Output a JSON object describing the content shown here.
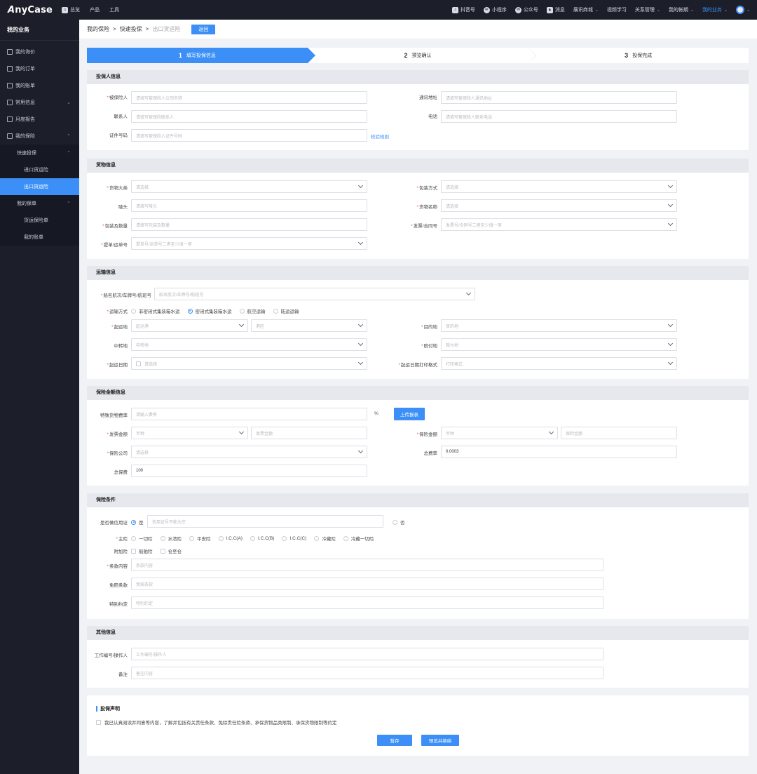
{
  "brand": {
    "logo_prefix": "A",
    "logo_rest": "nyCase"
  },
  "topnav": {
    "overview": "总览",
    "product": "产品",
    "tools": "工具"
  },
  "topright": {
    "douyin": "抖音号",
    "miniprogram": "小程序",
    "official": "公众号",
    "message": "消息",
    "mall": "展讯商城",
    "learning": "视频学习",
    "relation": "关系管理",
    "mine": "我的帐期",
    "business": "我的业务"
  },
  "sidebar": {
    "title": "我的业务",
    "items": [
      "我的询价",
      "我的订单",
      "我的账单",
      "常用信息",
      "月度报告",
      "我的保险",
      "快速投保",
      "进口货运险",
      "出口货运险",
      "我的保单",
      "货运保险单",
      "我的账单"
    ]
  },
  "breadcrumb": {
    "a": "我的保险",
    "b": "快速投保",
    "c": "出口货运险",
    "back": "返回",
    "sep": ">"
  },
  "steps": [
    {
      "num": "1",
      "label": "填写投保信息"
    },
    {
      "num": "2",
      "label": "预览确认"
    },
    {
      "num": "3",
      "label": "投保完成"
    }
  ],
  "insurer": {
    "title": "投保人信息",
    "insured_label": "被保险人",
    "insured_ph": "请填写被保险人公司名称",
    "address_label": "通讯地址",
    "address_ph": "请填写被保险人通讯地址",
    "contact_label": "联系人",
    "contact_ph": "请填写被保险联系人",
    "phone_label": "电话",
    "phone_ph": "请填写被保险人联系电话",
    "id_label": "证件号码",
    "id_ph": "请填写被保险人证件号码",
    "rule_link": "校验规则"
  },
  "goods": {
    "title": "货物信息",
    "category_label": "货物大类",
    "category_ph": "请选择",
    "pack_label": "包装方式",
    "pack_ph": "请选择",
    "mark_label": "唛头",
    "mark_ph": "请填写唛头",
    "name_label": "货物名称",
    "name_ph": "请选择",
    "qty_label": "包装及数量",
    "qty_ph": "请填写包装及数量",
    "invoice_label": "发票/合同号",
    "invoice_ph": "发票号/合同号二者至少填一项",
    "bl_label": "提单/运单号",
    "bl_ph": "提单号/运单号二者至少填一项"
  },
  "transport": {
    "title": "运输信息",
    "vessel_label": "船名航次/车牌号/航班号",
    "vessel_ph": "船名航次/车牌号/航班号",
    "mode_label": "运输方式",
    "modes": [
      "非密闭式集装箱水运",
      "密闭式集装箱水运",
      "航空运输",
      "陆运运输"
    ],
    "mode_selected": 1,
    "origin_label": "起运地",
    "origin_ph": "起运港",
    "origin_ph2": "港区",
    "dest_label": "目的地",
    "dest_ph": "目的地",
    "transit_label": "中转地",
    "transit_ph": "中转地",
    "pay_label": "赔付地",
    "pay_ph": "赔付地",
    "date_label": "起运日期",
    "date_ph": "请选择",
    "datefmt_label": "起运日期打印格式",
    "datefmt_ph": "打印格式"
  },
  "amount": {
    "title": "保险金额信息",
    "rate_label": "特殊货物费率",
    "rate_ph": "请输入费率",
    "percent": "%",
    "upload_btn": "上传报表",
    "invoice_amt_label": "发票金额",
    "currency_ph": "币种",
    "invoice_amt_ph": "发票金额",
    "insured_amt_label": "保险金额",
    "insured_currency_ph": "币种",
    "insured_amt_ph": "保险金额",
    "company_label": "保险公司",
    "company_ph": "请选择",
    "total_rate_label": "总费率",
    "total_rate_val": "0.0003",
    "premium_label": "总保费",
    "premium_val": "100"
  },
  "conditions": {
    "title": "保险条件",
    "credit_label": "是否做信用证",
    "yes": "是",
    "credit_ph": "信用证号不能为空",
    "no": "否",
    "main_label": "主险",
    "main_options": [
      "一切险",
      "水渍险",
      "平安险",
      "I.C.C(A)",
      "I.C.C(B)",
      "I.C.C(C)",
      "冷藏险",
      "冷藏一切险"
    ],
    "extra_label": "附加险",
    "extra_options": [
      "船舶险",
      "仓至仓"
    ],
    "clause_label": "条款内容",
    "clause_ph": "条款内容",
    "deductible_label": "免赔条款",
    "deductible_ph": "免赔条款",
    "special_label": "特别约定",
    "special_ph": "特别约定"
  },
  "other": {
    "title": "其他信息",
    "worker_label": "工作编号/操作人",
    "worker_ph": "工作编号/操作人",
    "remark_label": "备注",
    "remark_ph": "备注内容"
  },
  "declaration": {
    "title": "投保声明",
    "text": "我已认真阅读并同意等内容，了解并包括有关责任条款、免除责任险条款、承保货物品类限制、承保货物限制等约定",
    "save_btn": "暂存",
    "submit_btn": "预览并继续"
  },
  "colors": {
    "accent": "#3b8ff6",
    "dark": "#1c1f2a",
    "section_head": "#e6e8ee"
  }
}
